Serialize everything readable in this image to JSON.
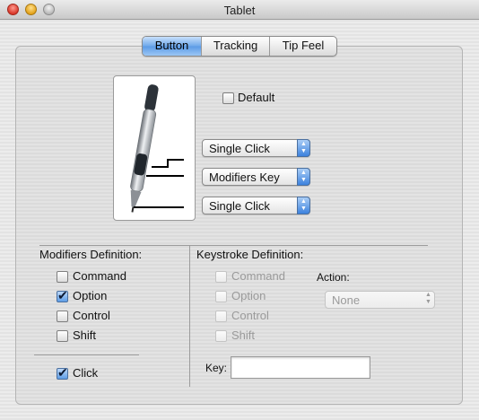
{
  "window": {
    "title": "Tablet"
  },
  "tabs": [
    {
      "label": "Button",
      "active": true
    },
    {
      "label": "Tracking",
      "active": false
    },
    {
      "label": "Tip Feel",
      "active": false
    }
  ],
  "default_checkbox": {
    "label": "Default",
    "checked": false
  },
  "button_popups": [
    {
      "value": "Single Click"
    },
    {
      "value": "Modifiers Key"
    },
    {
      "value": "Single Click"
    }
  ],
  "modifiers": {
    "title": "Modifiers Definition:",
    "items": [
      {
        "label": "Command",
        "checked": false
      },
      {
        "label": "Option",
        "checked": true
      },
      {
        "label": "Control",
        "checked": false
      },
      {
        "label": "Shift",
        "checked": false
      }
    ],
    "click": {
      "label": "Click",
      "checked": true
    }
  },
  "keystroke": {
    "title": "Keystroke Definition:",
    "items": [
      {
        "label": "Command",
        "checked": false
      },
      {
        "label": "Option",
        "checked": false
      },
      {
        "label": "Control",
        "checked": false
      },
      {
        "label": "Shift",
        "checked": false
      }
    ],
    "action_label": "Action:",
    "action_value": "None",
    "key_label": "Key:",
    "key_value": ""
  },
  "colors": {
    "accent": "#5b9be6",
    "disabled_text": "#9a9a9a"
  }
}
